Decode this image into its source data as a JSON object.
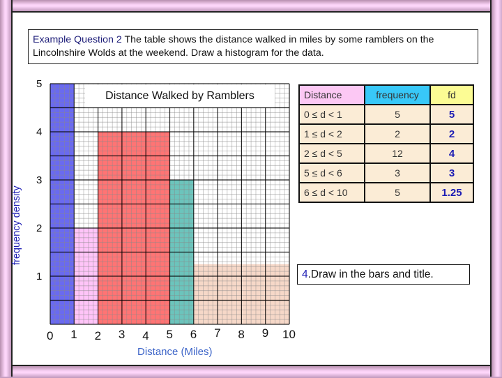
{
  "question": {
    "lead": "Example Question 2",
    "text": " The table shows the distance walked in miles by some ramblers on the Lincolnshire Wolds at the weekend.  Draw a histogram for the data."
  },
  "table": {
    "headers": [
      "Distance",
      "frequency",
      "fd"
    ],
    "rows": [
      {
        "distance": "0 ≤ d < 1",
        "frequency": "5",
        "fd": "5"
      },
      {
        "distance": "1 ≤ d < 2",
        "frequency": "2",
        "fd": "2"
      },
      {
        "distance": "2 ≤ d < 5",
        "frequency": "12",
        "fd": "4"
      },
      {
        "distance": "5 ≤ d < 6",
        "frequency": "3",
        "fd": "3"
      },
      {
        "distance": "6 ≤ d < 10",
        "frequency": "5",
        "fd": "1.25"
      }
    ],
    "header_colors": [
      "#fcc8f4",
      "#38c8f8",
      "#fcfc94"
    ]
  },
  "instruction": {
    "number": "4",
    "text": ".Draw in the bars and title."
  },
  "chart_data": {
    "type": "bar",
    "subtype": "histogram",
    "title": "Distance Walked by Ramblers",
    "xlabel": "Distance (Miles)",
    "ylabel": "frequency density",
    "xlim": [
      0,
      10
    ],
    "ylim": [
      0,
      5
    ],
    "grid": true,
    "x_ticks": [
      "0",
      "1",
      "2",
      "3",
      "4",
      "5",
      "6",
      "7",
      "8",
      "9",
      "10"
    ],
    "y_ticks": [
      "1",
      "2",
      "3",
      "4",
      "5"
    ],
    "bins": [
      {
        "from": 0,
        "to": 1,
        "frequency_density": 5,
        "color": "#6a6af0"
      },
      {
        "from": 1,
        "to": 2,
        "frequency_density": 2,
        "color": "#ffc4f8"
      },
      {
        "from": 2,
        "to": 5,
        "frequency_density": 4,
        "color": "#ff7474"
      },
      {
        "from": 5,
        "to": 6,
        "frequency_density": 3,
        "color": "#6cc4bc"
      },
      {
        "from": 6,
        "to": 10,
        "frequency_density": 1.25,
        "color": "#f6d8c8"
      }
    ]
  }
}
